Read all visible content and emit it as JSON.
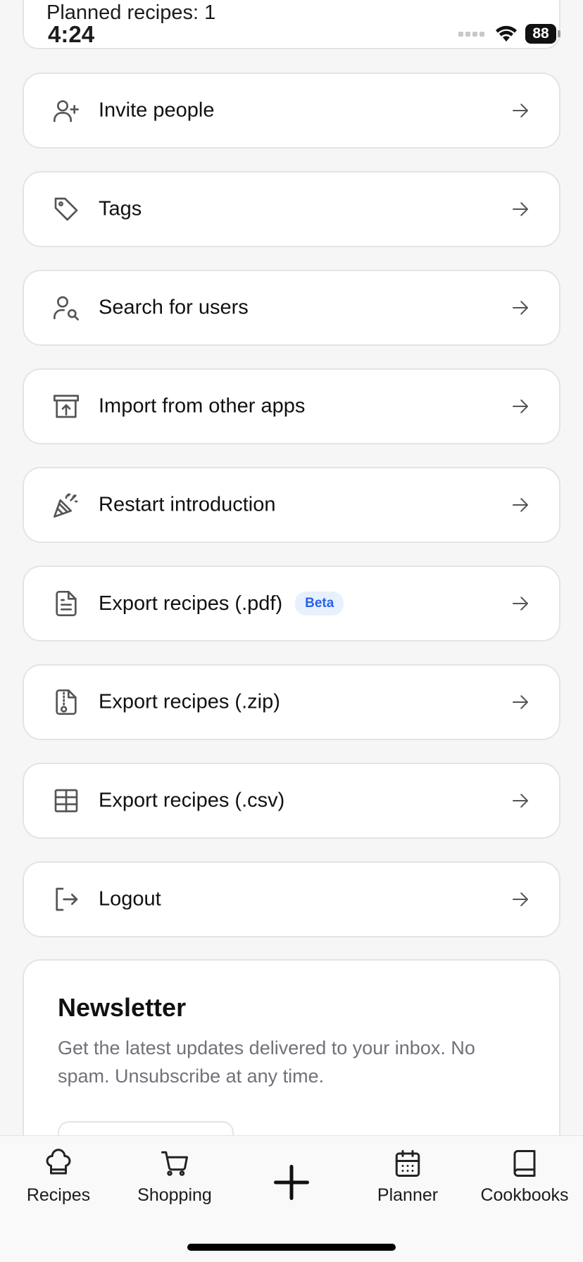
{
  "status_bar": {
    "planned_text": "Planned recipes: 1",
    "time": "4:24",
    "battery": "88"
  },
  "menu": {
    "items": [
      {
        "label": "Invite people",
        "icon": "user-plus-icon"
      },
      {
        "label": "Tags",
        "icon": "tag-icon"
      },
      {
        "label": "Search for users",
        "icon": "user-search-icon"
      },
      {
        "label": "Import from other apps",
        "icon": "archive-upload-icon"
      },
      {
        "label": "Restart introduction",
        "icon": "party-popper-icon"
      },
      {
        "label": "Export recipes (.pdf)",
        "icon": "file-text-icon",
        "badge": "Beta"
      },
      {
        "label": "Export recipes (.zip)",
        "icon": "file-archive-icon"
      },
      {
        "label": "Export recipes (.csv)",
        "icon": "table-icon"
      },
      {
        "label": "Logout",
        "icon": "logout-icon"
      }
    ]
  },
  "newsletter": {
    "title": "Newsletter",
    "text": "Get the latest updates delivered to your inbox. No spam. Unsubscribe at any time."
  },
  "tabbar": {
    "tabs": [
      {
        "label": "Recipes",
        "icon": "chef-hat-icon"
      },
      {
        "label": "Shopping",
        "icon": "shopping-cart-icon"
      },
      {
        "label": "Planner",
        "icon": "calendar-icon"
      },
      {
        "label": "Cookbooks",
        "icon": "book-icon"
      }
    ],
    "add_icon": "plus-icon"
  },
  "colors": {
    "background": "#f6f6f6",
    "card": "#ffffff",
    "border": "#e4e4e7",
    "text": "#111111",
    "muted": "#71717a",
    "beta_text": "#2563eb",
    "beta_bg": "#e8f0fd"
  }
}
